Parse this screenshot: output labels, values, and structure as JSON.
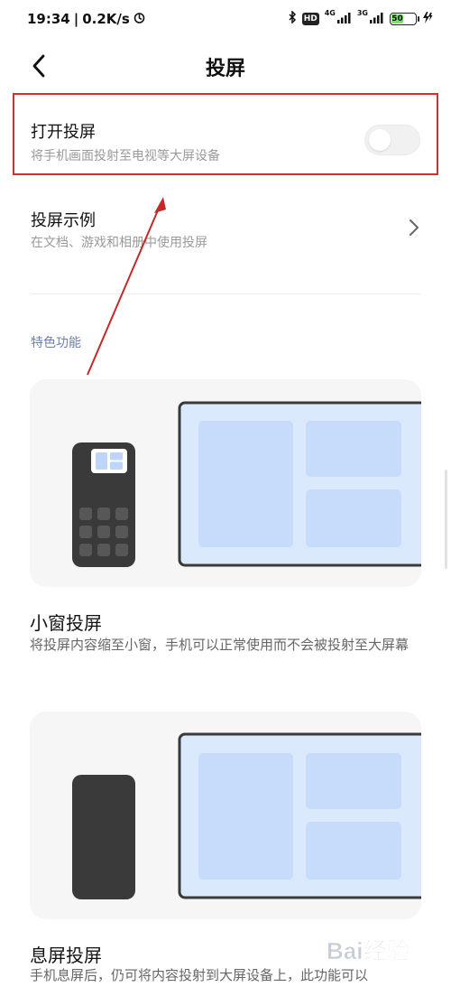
{
  "status_bar": {
    "time": "19:34",
    "speed": "0.2K/s",
    "network_1": "4G",
    "network_2": "3G",
    "hd": "HD",
    "battery_level": "50",
    "battery_color": "#7be06a"
  },
  "header": {
    "title": "投屏",
    "back_icon": "chevron-left-icon"
  },
  "settings": {
    "cast_toggle": {
      "title": "打开投屏",
      "subtitle": "将手机画面投射至电视等大屏设备",
      "enabled": false
    },
    "cast_examples": {
      "title": "投屏示例",
      "subtitle": "在文档、游戏和相册中使用投屏"
    }
  },
  "features": {
    "section_label": "特色功能",
    "items": [
      {
        "title": "小窗投屏",
        "description": "将投屏内容缩至小窗，手机可以正常使用而不会被投射至大屏幕"
      },
      {
        "title": "息屏投屏",
        "description": "手机息屏后，仍可将内容投射到大屏设备上，此功能可以"
      }
    ]
  },
  "watermark": {
    "text": "Bai经验"
  },
  "colors": {
    "highlight": "#d32f2f",
    "section_label": "#6c7fb0",
    "card_bg": "#f6f6f6",
    "screen_fill": "#cfe2fb"
  }
}
